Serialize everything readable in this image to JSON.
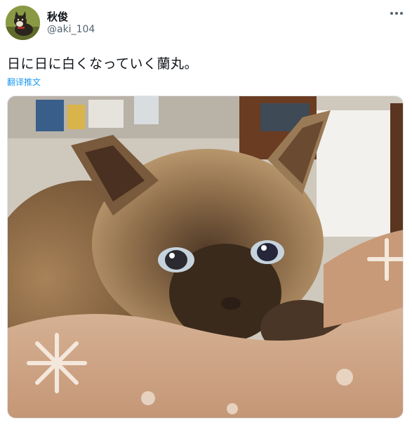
{
  "tweet": {
    "author": {
      "display_name": "秋俊",
      "handle": "@aki_104",
      "avatar_icon": "shiba-dog-avatar-icon"
    },
    "text": "日に日に白くなっていく蘭丸。",
    "translate_label": "翻译推文",
    "more_icon": "more-horizontal-icon",
    "media": {
      "subject": "cat-photo"
    }
  },
  "colors": {
    "link": "#1d9bf0",
    "text_primary": "#0f1419",
    "text_secondary": "#536471"
  }
}
